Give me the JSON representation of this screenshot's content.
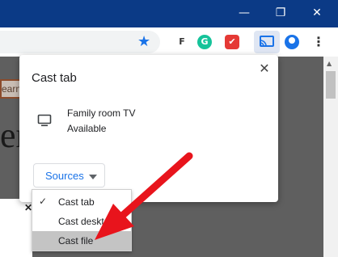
{
  "window": {
    "minimize_glyph": "—",
    "restore_glyph": "❐",
    "close_glyph": "✕"
  },
  "toolbar": {
    "star_icon": "star-icon",
    "extensions": [
      {
        "name": "f-extension-icon",
        "glyph": "F",
        "color": "#333333"
      },
      {
        "name": "grammarly-icon",
        "glyph": "G",
        "color": "#15c39a"
      },
      {
        "name": "red-extension-icon",
        "glyph": "✔",
        "color": "#e53935"
      }
    ],
    "kebab_glyph": "⋮"
  },
  "page": {
    "tag_text": "earn",
    "big_text": "er",
    "dismiss_glyph": "✕"
  },
  "cast_dialog": {
    "title": "Cast tab",
    "close_glyph": "✕",
    "sink": {
      "name": "Family room TV",
      "status": "Available"
    },
    "sources_label": "Sources"
  },
  "sources_menu": {
    "items": [
      {
        "label": "Cast tab",
        "checked": true,
        "highlighted": false
      },
      {
        "label": "Cast desktop",
        "checked": false,
        "highlighted": false
      },
      {
        "label": "Cast file",
        "checked": false,
        "highlighted": true
      }
    ],
    "check_glyph": "✓"
  },
  "colors": {
    "titlebar": "#0b3a86",
    "accent": "#1a73e8",
    "annotation_arrow": "#e8141c"
  }
}
